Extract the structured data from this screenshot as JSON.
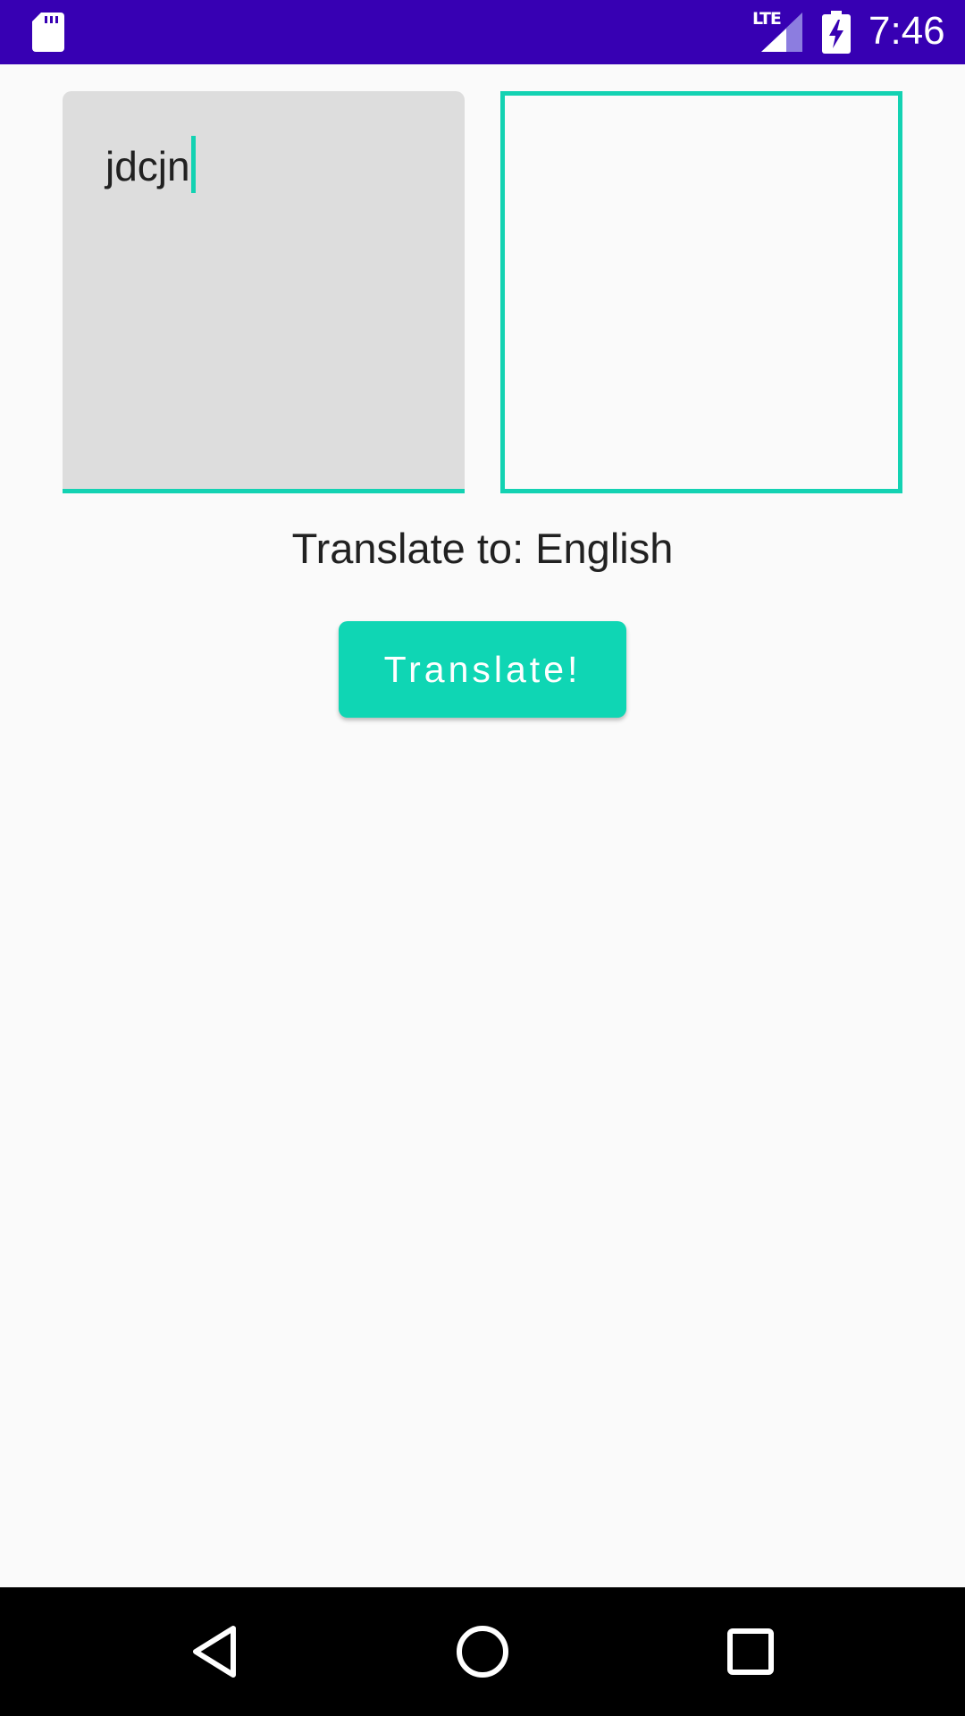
{
  "status_bar": {
    "time": "7:46",
    "network": "LTE",
    "background_color": "#3700b3",
    "icons": [
      "sd-card-icon",
      "signal-icon",
      "battery-charging-icon"
    ]
  },
  "input": {
    "value": "jdcjn",
    "accent_color": "#13d2b2"
  },
  "output": {
    "value": ""
  },
  "translate_to_label": "Translate to: English",
  "translate_button_label": "Translate!",
  "nav_bar": {
    "icons": [
      "back-icon",
      "home-icon",
      "recents-icon"
    ]
  }
}
